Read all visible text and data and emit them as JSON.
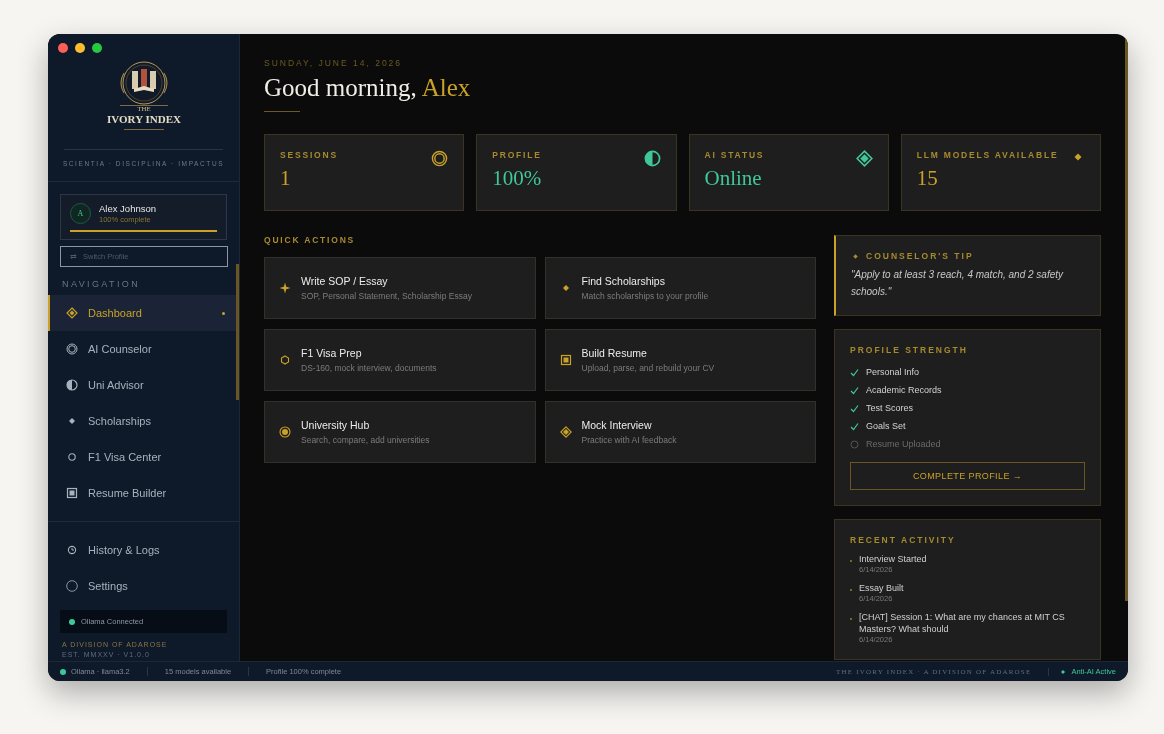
{
  "sidebar": {
    "logo": {
      "top": "THE",
      "name": "IVORY INDEX"
    },
    "motto": "SCIENTIA · DISCIPLINA · IMPACTUS",
    "profile": {
      "initial": "A",
      "name": "Alex Johnson",
      "status": "100% complete",
      "level": 1.0
    },
    "switch_profile": {
      "icon": "⇄",
      "label": "Switch Profile"
    },
    "nav_heading": "NAVIGATION",
    "nav": [
      {
        "label": "Dashboard",
        "selected": true
      },
      {
        "label": "AI Counselor",
        "selected": false
      },
      {
        "label": "Uni Advisor",
        "selected": false
      },
      {
        "label": "Scholarships",
        "selected": false
      },
      {
        "label": "F1 Visa Center",
        "selected": false
      },
      {
        "label": "Resume Builder",
        "selected": false
      }
    ],
    "bottom_nav": [
      {
        "label": "History & Logs",
        "selected": false
      },
      {
        "label": "Settings",
        "selected": false
      }
    ],
    "connection": {
      "label": "Ollama Connected",
      "on": true
    },
    "footer": [
      "A DIVISION OF ADAROSE",
      "EST. MMXXV · V1.0.0"
    ]
  },
  "main": {
    "date": "SUNDAY, JUNE 14, 2026",
    "greeting": "Good morning,",
    "name": "Alex",
    "stats": [
      {
        "label": "SESSIONS",
        "value": "1",
        "color": "#c9a227"
      },
      {
        "label": "PROFILE",
        "value": "100%",
        "color": "#3fc79a"
      },
      {
        "label": "AI STATUS",
        "value": "Online",
        "color": "#3fc79a"
      },
      {
        "label": "LLM MODELS AVAILABLE",
        "value": "15",
        "color": "#c9a227"
      }
    ],
    "quick_heading": "QUICK ACTIONS",
    "actions": [
      {
        "title": "Write SOP / Essay",
        "subtitle": "SOP, Personal Statement, Scholarship Essay"
      },
      {
        "title": "Find Scholarships",
        "subtitle": "Match scholarships to your profile"
      },
      {
        "title": "F1 Visa Prep",
        "subtitle": "DS-160, mock interview, documents"
      },
      {
        "title": "Build Resume",
        "subtitle": "Upload, parse, and rebuild your CV"
      },
      {
        "title": "University Hub",
        "subtitle": "Search, compare, add universities"
      },
      {
        "title": "Mock Interview",
        "subtitle": "Practice with AI feedback"
      }
    ],
    "tip": {
      "heading": "COUNSELOR'S TIP",
      "text": "\"Apply to at least 3 reach, 4 match, and 2 safety schools.\""
    },
    "strength": {
      "heading": "PROFILE STRENGTH",
      "items": [
        {
          "label": "Personal Info",
          "checked": true
        },
        {
          "label": "Academic Records",
          "checked": true
        },
        {
          "label": "Test Scores",
          "checked": true
        },
        {
          "label": "Goals Set",
          "checked": true
        },
        {
          "label": "Resume Uploaded",
          "checked": false
        }
      ],
      "button": "COMPLETE PROFILE →"
    },
    "activity": {
      "heading": "RECENT ACTIVITY",
      "items": [
        {
          "title": "Interview Started",
          "date": "6/14/2026"
        },
        {
          "title": "Essay Built",
          "date": "6/14/2026"
        },
        {
          "title": "[CHAT] Session 1: What are my chances at MIT CS Masters? What should",
          "date": "6/14/2026"
        }
      ]
    }
  },
  "status_bar": {
    "items": [
      "Ollama · llama3.2",
      "15 models available",
      "Profile 100% complete"
    ],
    "brand": "THE IVORY INDEX · A DIVISION OF ADAROSE",
    "badge": "Anti-AI Active"
  }
}
